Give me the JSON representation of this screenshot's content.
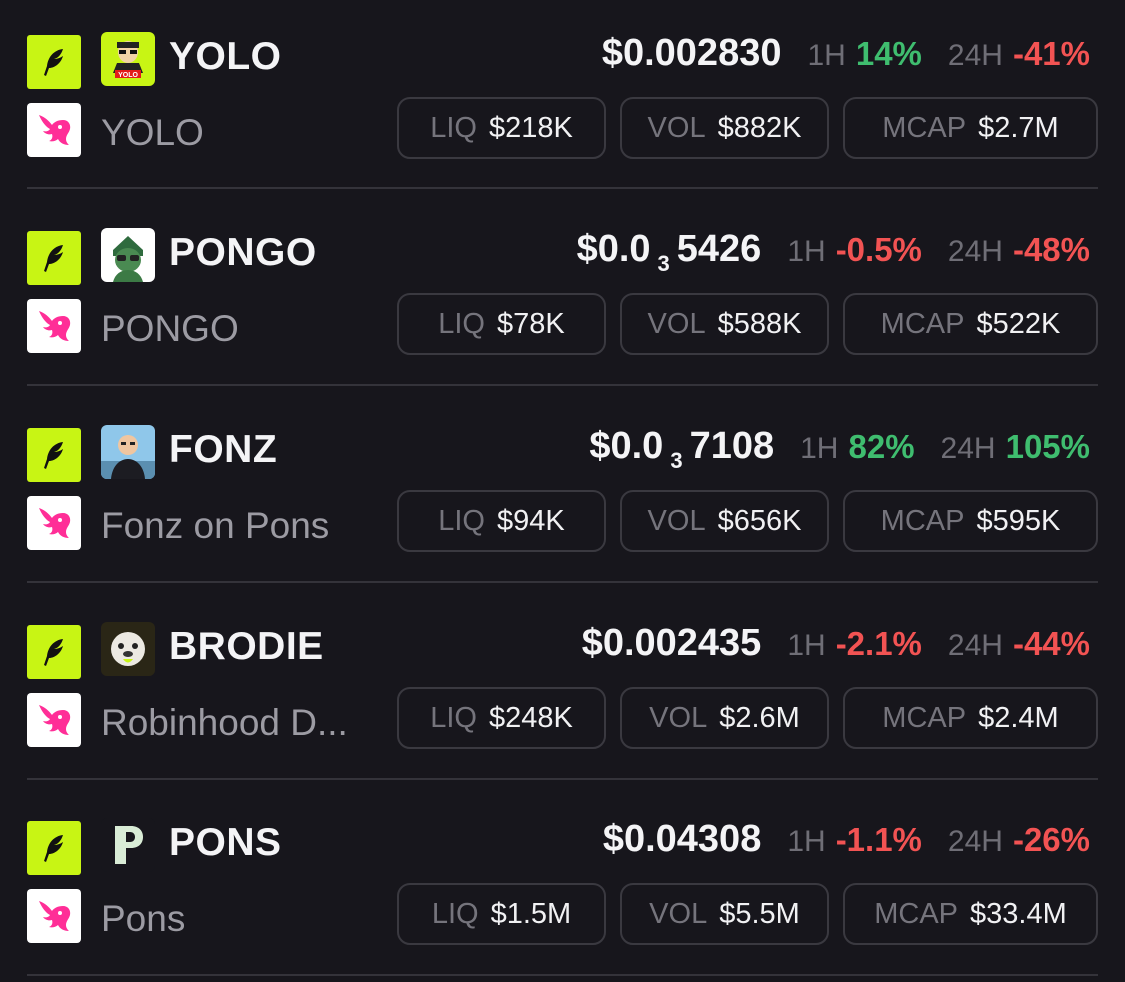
{
  "labels": {
    "h1": "1H",
    "h24": "24H",
    "liq": "LIQ",
    "vol": "VOL",
    "mcap": "MCAP"
  },
  "colors": {
    "up": "#3fbd6f",
    "down": "#f25353",
    "chain": "#c8f514",
    "dex": "#ff2e97"
  },
  "icons": {
    "chain": "feather-icon",
    "dex": "unicorn-icon"
  },
  "tokens": [
    {
      "symbol": "YOLO",
      "name": "YOLO",
      "price_main": "$0.002830",
      "price_sub": "",
      "price_tail": "",
      "h1": "14%",
      "h1_dir": "up",
      "h24": "-41%",
      "h24_dir": "down",
      "liq": "$218K",
      "vol": "$882K",
      "mcap": "$2.7M",
      "avatar": "yolo-avatar"
    },
    {
      "symbol": "PONGO",
      "name": "PONGO",
      "price_main": "$0.0",
      "price_sub": "3",
      "price_tail": "5426",
      "h1": "-0.5%",
      "h1_dir": "down",
      "h24": "-48%",
      "h24_dir": "down",
      "liq": "$78K",
      "vol": "$588K",
      "mcap": "$522K",
      "avatar": "pongo-avatar"
    },
    {
      "symbol": "FONZ",
      "name": "Fonz on Pons",
      "price_main": "$0.0",
      "price_sub": "3",
      "price_tail": "7108",
      "h1": "82%",
      "h1_dir": "up",
      "h24": "105%",
      "h24_dir": "up",
      "liq": "$94K",
      "vol": "$656K",
      "mcap": "$595K",
      "avatar": "fonz-avatar"
    },
    {
      "symbol": "BRODIE",
      "name": "Robinhood D...",
      "price_main": "$0.002435",
      "price_sub": "",
      "price_tail": "",
      "h1": "-2.1%",
      "h1_dir": "down",
      "h24": "-44%",
      "h24_dir": "down",
      "liq": "$248K",
      "vol": "$2.6M",
      "mcap": "$2.4M",
      "avatar": "brodie-avatar"
    },
    {
      "symbol": "PONS",
      "name": "Pons",
      "price_main": "$0.04308",
      "price_sub": "",
      "price_tail": "",
      "h1": "-1.1%",
      "h1_dir": "down",
      "h24": "-26%",
      "h24_dir": "down",
      "liq": "$1.5M",
      "vol": "$5.5M",
      "mcap": "$33.4M",
      "avatar": "pons-avatar"
    }
  ]
}
